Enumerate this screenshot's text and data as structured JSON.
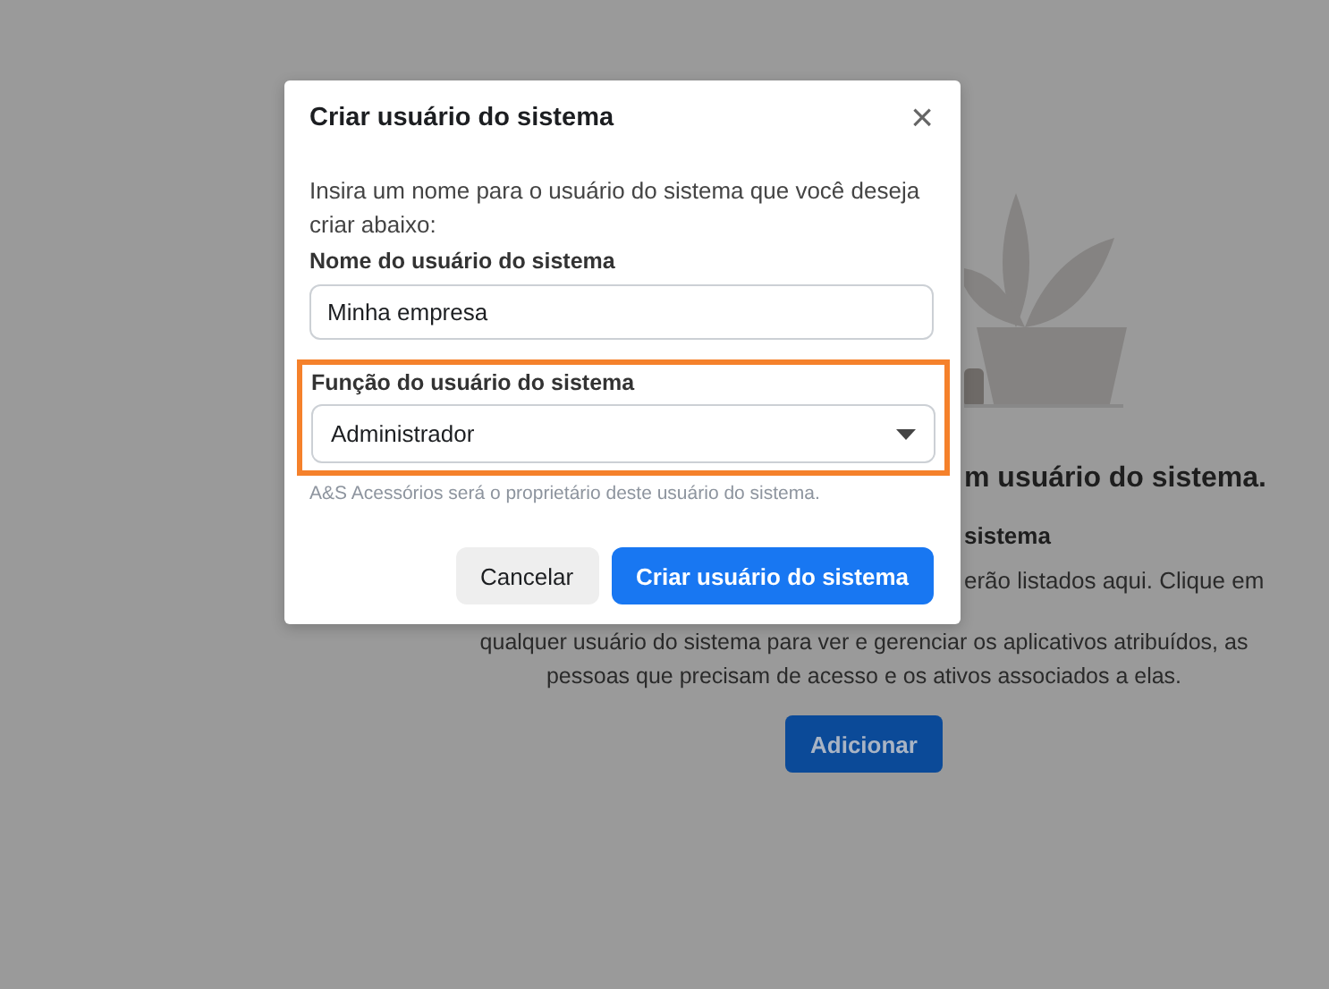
{
  "background": {
    "heading": "m usuário do sistema.",
    "subheading": "sistema",
    "description_lines": [
      "erão listados aqui. Clique em",
      "qualquer usuário do sistema para ver e gerenciar os aplicativos atribuídos, as",
      "pessoas que precisam de acesso e os ativos associados a elas."
    ],
    "add_button": "Adicionar"
  },
  "dialog": {
    "title": "Criar usuário do sistema",
    "close": "×",
    "description": "Insira um nome para o usuário do sistema que você deseja criar abaixo:",
    "name_field": {
      "label": "Nome do usuário do sistema",
      "value": "Minha empresa"
    },
    "role_field": {
      "label": "Função do usuário do sistema",
      "value": "Administrador",
      "highlighted": true
    },
    "helper": "A&S Acessórios será o proprietário deste usuário do sistema.",
    "buttons": [
      {
        "label": "Cancelar",
        "kind": "secondary"
      },
      {
        "label": "Criar usuário do sistema",
        "kind": "primary"
      }
    ]
  }
}
